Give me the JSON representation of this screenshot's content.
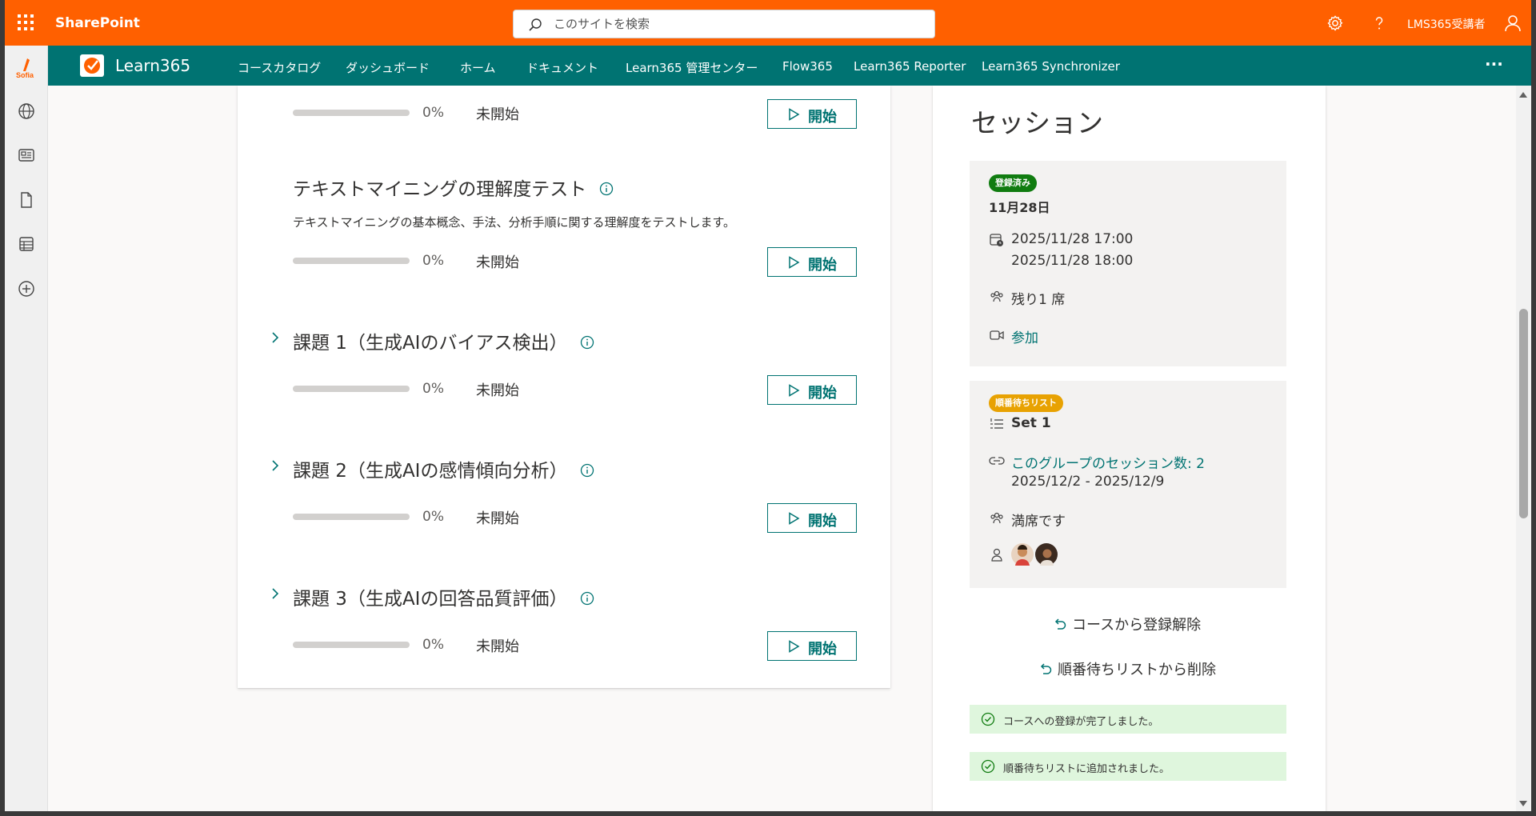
{
  "suitebar": {
    "app_name": "SharePoint",
    "search_placeholder": "このサイトを検索",
    "user_name": "LMS365受講者",
    "bg_color": "#ff6000"
  },
  "leftrail": {
    "logo_text": "Sofia",
    "icons": [
      "globe-icon",
      "news-icon",
      "document-icon",
      "list-icon",
      "add-circle-icon"
    ]
  },
  "hubnav": {
    "title": "Learn365",
    "items": [
      "コースカタログ",
      "ダッシュボード",
      "ホーム",
      "ドキュメント",
      "Learn365 管理センター",
      "Flow365",
      "Learn365 Reporter",
      "Learn365 Synchronizer"
    ],
    "more_label": "···",
    "bg_color": "#007372"
  },
  "course": {
    "items": [
      {
        "title": "",
        "description": "",
        "progress_label": "0%",
        "progress": 0,
        "status": "未開始",
        "button": "開始"
      },
      {
        "title": "テキストマイニングの理解度テスト",
        "description": "テキストマイニングの基本概念、手法、分析手順に関する理解度をテストします。",
        "progress_label": "0%",
        "progress": 0,
        "status": "未開始",
        "button": "開始"
      },
      {
        "title": "課題 1（生成AIのバイアス検出）",
        "description": "",
        "progress_label": "0%",
        "progress": 0,
        "status": "未開始",
        "button": "開始"
      },
      {
        "title": "課題 2（生成AIの感情傾向分析）",
        "description": "",
        "progress_label": "0%",
        "progress": 0,
        "status": "未開始",
        "button": "開始"
      },
      {
        "title": "課題 3（生成AIの回答品質評価）",
        "description": "",
        "progress_label": "0%",
        "progress": 0,
        "status": "未開始",
        "button": "開始"
      }
    ]
  },
  "session": {
    "title": "セッション",
    "enrolled": {
      "badge": "登録済み",
      "badge_color": "#107c10",
      "date": "11月28日",
      "start": "2025/11/28 17:00",
      "end": "2025/11/28 18:00",
      "seats": "残り1 席",
      "join": "参加"
    },
    "waitlist": {
      "badge": "順番待ちリスト",
      "badge_color": "#e8a202",
      "set_name": "Set 1",
      "group_link": "このグループのセッション数: 2",
      "range": "2025/12/2 - 2025/12/9",
      "seats": "満席です"
    },
    "unenroll": "コースから登録解除",
    "remove_waitlist": "順番待ちリストから削除",
    "toasts": [
      "コースへの登録が完了しました。",
      "順番待ちリストに追加されました。"
    ]
  }
}
